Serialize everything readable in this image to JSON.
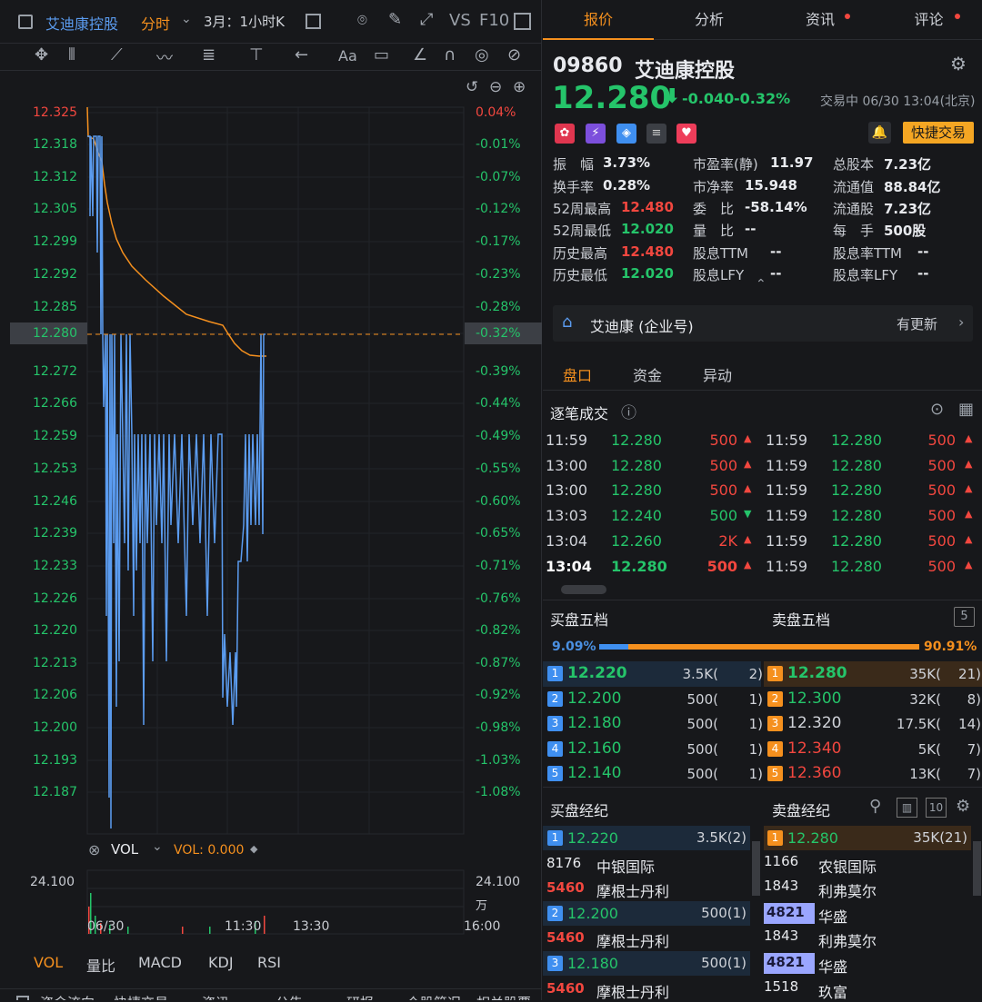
{
  "left": {
    "toolbar": {
      "stock_name": "艾迪康控股",
      "mode": "分时",
      "period": "3月：1小时K",
      "vs": "VS",
      "f10": "F10"
    },
    "price_axis": [
      "12.325",
      "12.318",
      "12.312",
      "12.305",
      "12.299",
      "12.292",
      "12.285",
      "12.280",
      "12.272",
      "12.266",
      "12.259",
      "12.253",
      "12.246",
      "12.239",
      "12.233",
      "12.226",
      "12.220",
      "12.213",
      "12.206",
      "12.200",
      "12.193",
      "12.187"
    ],
    "pct_axis": [
      "0.04%",
      "-0.01%",
      "-0.07%",
      "-0.12%",
      "-0.17%",
      "-0.23%",
      "-0.28%",
      "-0.32%",
      "-0.39%",
      "-0.44%",
      "-0.49%",
      "-0.55%",
      "-0.60%",
      "-0.65%",
      "-0.71%",
      "-0.76%",
      "-0.82%",
      "-0.87%",
      "-0.92%",
      "-0.98%",
      "-1.03%",
      "-1.08%"
    ],
    "vol_label": "VOL",
    "vol_value": "VOL: 0.000",
    "vol_max": "24.100",
    "vol_unit": "万",
    "time_axis": [
      "06/30",
      "11:30",
      "13:30",
      "16:00"
    ],
    "indicator_tabs": [
      "VOL",
      "量比",
      "MACD",
      "KDJ",
      "RSI"
    ],
    "bottom_tabs": [
      "资金流向",
      "快捷交易",
      "资讯",
      "公告",
      "研报",
      "个股简况",
      "相关股票"
    ],
    "colors": {
      "price_line": "#5b9cf0",
      "avg_line": "#f5901e",
      "green": "#25c46a",
      "red": "#f2473f"
    }
  },
  "right": {
    "tabs": [
      "报价",
      "分析",
      "资讯",
      "评论"
    ],
    "code": "09860",
    "name": "艾迪康控股",
    "price": "12.280",
    "change": "-0.040",
    "change_pct": "-0.32%",
    "status": "交易中 06/30 13:04(北京)",
    "quick_trade": "快捷交易",
    "stats": [
      [
        {
          "k": "振　幅",
          "v": "3.73%"
        },
        {
          "k": "市盈率(静)",
          "v": "11.97"
        },
        {
          "k": "总股本",
          "v": "7.23亿"
        }
      ],
      [
        {
          "k": "换手率",
          "v": "0.28%"
        },
        {
          "k": "市净率",
          "v": "15.948"
        },
        {
          "k": "流通值",
          "v": "88.84亿"
        }
      ],
      [
        {
          "k": "52周最高",
          "v": "12.480"
        },
        {
          "k": "委　比",
          "v": "-58.14%"
        },
        {
          "k": "流通股",
          "v": "7.23亿"
        }
      ],
      [
        {
          "k": "52周最低",
          "v": "12.020"
        },
        {
          "k": "量　比",
          "v": "--"
        },
        {
          "k": "每　手",
          "v": "500股"
        }
      ],
      [
        {
          "k": "历史最高",
          "v": "12.480"
        },
        {
          "k": "股息TTM",
          "v": "--"
        },
        {
          "k": "股息率TTM",
          "v": "--"
        }
      ],
      [
        {
          "k": "历史最低",
          "v": "12.020"
        },
        {
          "k": "股息LFY",
          "v": "--"
        },
        {
          "k": "股息率LFY",
          "v": "--"
        }
      ]
    ],
    "company": {
      "label": "艾迪康 (企业号)",
      "update": "有更新"
    },
    "sub_tabs": [
      "盘口",
      "资金",
      "异动"
    ],
    "trades_title": "逐笔成交",
    "trades_left": [
      {
        "t": "11:59",
        "p": "12.280",
        "v": "500",
        "d": "up"
      },
      {
        "t": "13:00",
        "p": "12.280",
        "v": "500",
        "d": "up"
      },
      {
        "t": "13:00",
        "p": "12.280",
        "v": "500",
        "d": "up"
      },
      {
        "t": "13:03",
        "p": "12.240",
        "v": "500",
        "d": "down"
      },
      {
        "t": "13:04",
        "p": "12.260",
        "v": "2K",
        "d": "up"
      },
      {
        "t": "13:04",
        "p": "12.280",
        "v": "500",
        "d": "up"
      }
    ],
    "trades_right": [
      {
        "t": "11:59",
        "p": "12.280",
        "v": "500"
      },
      {
        "t": "11:59",
        "p": "12.280",
        "v": "500"
      },
      {
        "t": "11:59",
        "p": "12.280",
        "v": "500"
      },
      {
        "t": "11:59",
        "p": "12.280",
        "v": "500"
      },
      {
        "t": "11:59",
        "p": "12.280",
        "v": "500"
      },
      {
        "t": "11:59",
        "p": "12.280",
        "v": "500"
      }
    ],
    "buy5_title": "买盘五档",
    "sell5_title": "卖盘五档",
    "depth_badge": "5",
    "buy_ratio": "9.09%",
    "sell_ratio": "90.91%",
    "buy_ratio_value": 0.0909,
    "bids": [
      {
        "n": "1",
        "p": "12.220",
        "v": "3.5K(",
        "c": "2)"
      },
      {
        "n": "2",
        "p": "12.200",
        "v": "500(",
        "c": "1)"
      },
      {
        "n": "3",
        "p": "12.180",
        "v": "500(",
        "c": "1)"
      },
      {
        "n": "4",
        "p": "12.160",
        "v": "500(",
        "c": "1)"
      },
      {
        "n": "5",
        "p": "12.140",
        "v": "500(",
        "c": "1)"
      }
    ],
    "asks": [
      {
        "n": "1",
        "p": "12.280",
        "v": "35K(",
        "c": "21)"
      },
      {
        "n": "2",
        "p": "12.300",
        "v": "32K(",
        "c": "8)"
      },
      {
        "n": "3",
        "p": "12.320",
        "v": "17.5K(",
        "c": "14)"
      },
      {
        "n": "4",
        "p": "12.340",
        "v": "5K(",
        "c": "7)"
      },
      {
        "n": "5",
        "p": "12.360",
        "v": "13K(",
        "c": "7)"
      }
    ],
    "buy_broker_title": "买盘经纪",
    "sell_broker_title": "卖盘经纪",
    "broker_badge": "10",
    "buy_brokers": [
      {
        "type": "level",
        "n": "1",
        "p": "12.220",
        "v": "3.5K(2)"
      },
      {
        "type": "broker",
        "id": "8176",
        "name": "中银国际"
      },
      {
        "type": "broker",
        "id": "5460",
        "name": "摩根士丹利",
        "hl": true
      },
      {
        "type": "level",
        "n": "2",
        "p": "12.200",
        "v": "500(1)"
      },
      {
        "type": "broker",
        "id": "5460",
        "name": "摩根士丹利",
        "hl": true
      },
      {
        "type": "level",
        "n": "3",
        "p": "12.180",
        "v": "500(1)"
      },
      {
        "type": "broker",
        "id": "5460",
        "name": "摩根士丹利",
        "hl": true
      }
    ],
    "sell_brokers": [
      {
        "type": "level",
        "n": "1",
        "p": "12.280",
        "v": "35K(21)"
      },
      {
        "type": "broker",
        "id": "1166",
        "name": "农银国际"
      },
      {
        "type": "broker",
        "id": "1843",
        "name": "利弗莫尔"
      },
      {
        "type": "broker",
        "id": "4821",
        "name": "华盛",
        "box": true
      },
      {
        "type": "broker",
        "id": "1843",
        "name": "利弗莫尔"
      },
      {
        "type": "broker",
        "id": "4821",
        "name": "华盛",
        "box": true
      },
      {
        "type": "broker",
        "id": "1518",
        "name": "玖富"
      }
    ]
  }
}
